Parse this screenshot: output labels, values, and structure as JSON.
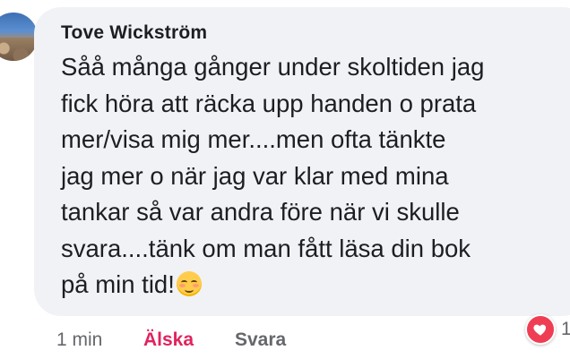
{
  "comment": {
    "author": "Tove Wickström",
    "text_lines": [
      "Såå många gånger under skoltiden jag",
      "fick höra att räcka upp handen o prata",
      "mer/visa mig mer....men ofta tänkte",
      "jag mer o när jag var klar med mina",
      "tankar så var andra före när vi skulle",
      "svara....tänk om man fått läsa din bok",
      "på min tid!"
    ],
    "emoji": "smiling-face-icon",
    "time": "1 min",
    "love_label": "Älska",
    "reply_label": "Svara",
    "reaction": {
      "icon": "heart-icon",
      "count": "1",
      "color": "#ef3e54"
    }
  },
  "colors": {
    "bubble": "#f1f2f6",
    "text": "#1c1e21",
    "muted": "#65676b",
    "love": "#e0245e"
  }
}
